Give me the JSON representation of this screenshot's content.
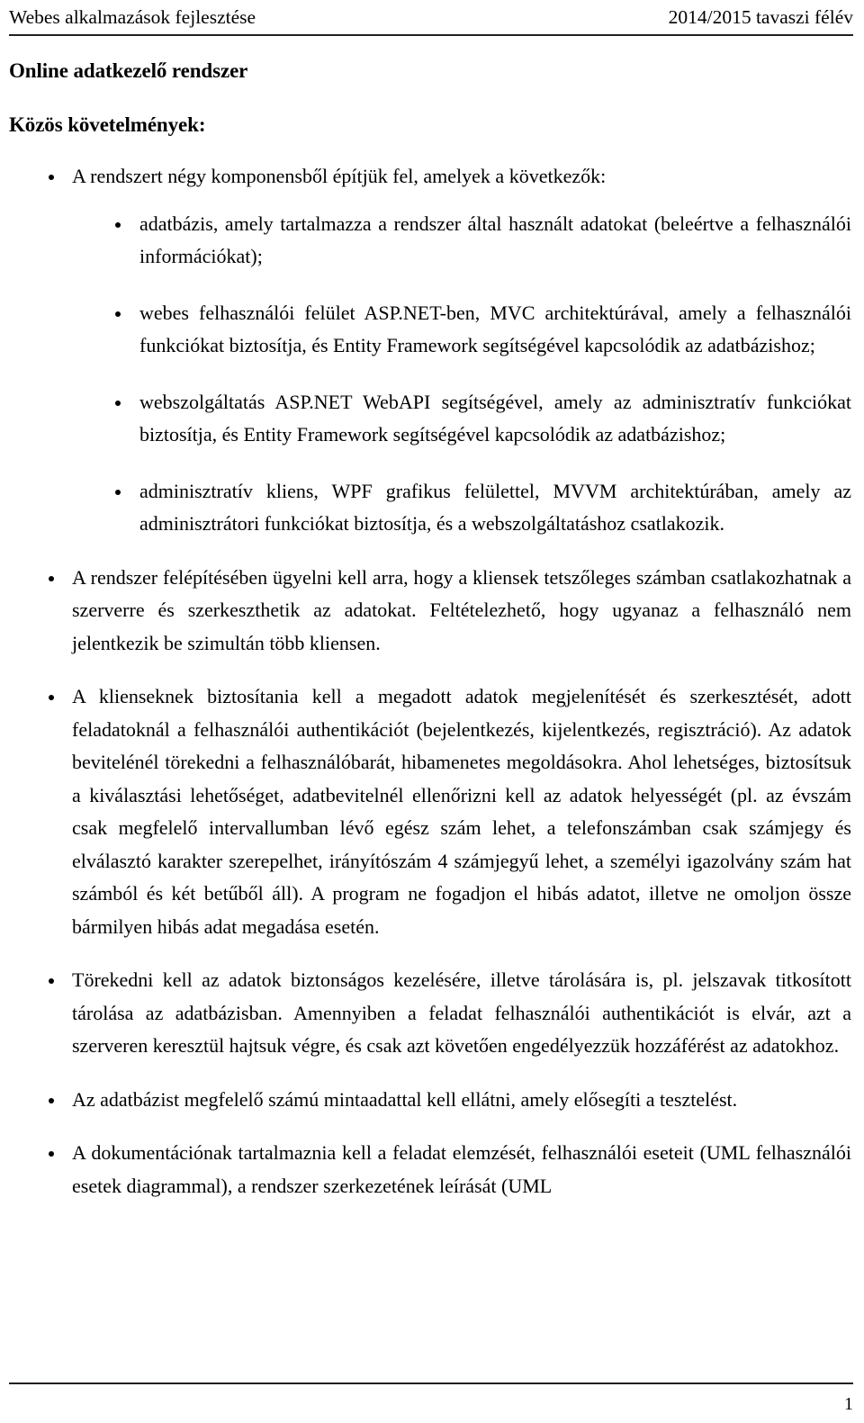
{
  "header": {
    "left": "Webes alkalmazások fejlesztése",
    "right": "2014/2015 tavaszi félév"
  },
  "document": {
    "title": "Online adatkezelő rendszer",
    "section_heading": "Közös követelmények:"
  },
  "requirements": {
    "intro_bullet": "A rendszert négy komponensből építjük fel, amelyek a következők:",
    "components": [
      "adatbázis, amely tartalmazza a rendszer által használt adatokat (beleértve a felhasználói információkat);",
      "webes felhasználói felület ASP.NET-ben, MVC architektúrával, amely a felhasználói funkciókat biztosítja, és Entity Framework segítségével kapcsolódik az adatbázishoz;",
      "webszolgáltatás ASP.NET WebAPI segítségével, amely az adminisztratív funkciókat biztosítja, és Entity Framework segítségével kapcsolódik az adatbázishoz;",
      "adminisztratív kliens, WPF grafikus felülettel, MVVM architektúrában, amely az adminisztrátori funkciókat biztosítja, és a webszolgáltatáshoz csatlakozik."
    ],
    "items": [
      "A rendszer felépítésében ügyelni kell arra, hogy a kliensek tetszőleges számban csatlakozhatnak a szerverre és szerkeszthetik az adatokat. Feltételezhető, hogy ugyanaz a felhasználó nem jelentkezik be szimultán több kliensen.",
      "A klienseknek biztosítania kell a megadott adatok megjelenítését és szerkesztését, adott feladatoknál a felhasználói authentikációt (bejelentkezés, kijelentkezés, regisztráció). Az adatok bevitelénél törekedni a felhasználóbarát, hibamenetes megoldásokra. Ahol lehetséges, biztosítsuk a kiválasztási lehetőséget, adatbevitelnél ellenőrizni kell az adatok helyességét (pl. az évszám csak megfelelő intervallumban lévő egész szám lehet, a telefonszámban csak számjegy és elválasztó karakter szerepelhet, irányítószám 4 számjegyű lehet, a személyi igazolvány szám hat számból és két betűből áll). A program ne fogadjon el hibás adatot, illetve ne omoljon össze bármilyen hibás adat megadása esetén.",
      "Törekedni kell az adatok biztonságos kezelésére, illetve tárolására is, pl. jelszavak titkosított tárolása az adatbázisban. Amennyiben a feladat felhasználói authentikációt is elvár, azt a szerveren keresztül hajtsuk végre, és csak azt követően engedélyezzük hozzáférést az adatokhoz.",
      "Az adatbázist megfelelő számú mintaadattal kell ellátni, amely elősegíti a tesztelést.",
      "A dokumentációnak tartalmaznia kell a feladat elemzését, felhasználói eseteit (UML felhasználói esetek diagrammal), a rendszer szerkezetének leírását (UML"
    ]
  },
  "footer": {
    "page_number": "1"
  }
}
